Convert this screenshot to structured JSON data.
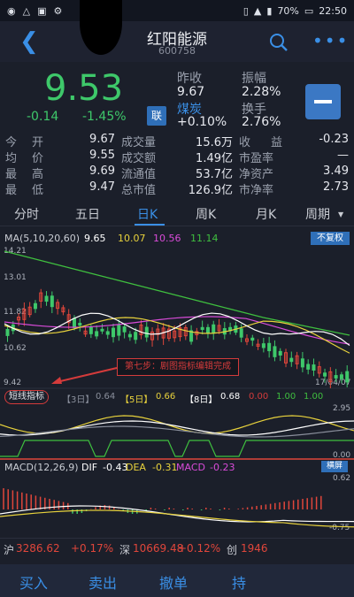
{
  "status": {
    "battery": "70%",
    "time": "22:50"
  },
  "header": {
    "title": "红阳能源",
    "code": "600758"
  },
  "quote": {
    "price": "9.53",
    "change": "-0.14",
    "change_pct": "-1.45%",
    "link_badge": "联",
    "prev_close_label": "昨收",
    "prev_close": "9.67",
    "sector_label": "煤炭",
    "sector_change": "+0.10%",
    "amplitude_label": "振幅",
    "amplitude": "2.28%",
    "turnover_label": "换手",
    "turnover": "2.76%"
  },
  "stats": [
    {
      "l1": "今",
      "l2": "开",
      "v": "9.67",
      "l3": "成交量",
      "v2": "15.6万",
      "l4": "收",
      "l5": "益",
      "v3": "-0.23"
    },
    {
      "l1": "均",
      "l2": "价",
      "v": "9.55",
      "l3": "成交额",
      "v2": "1.49亿",
      "l4": "市盈率",
      "l5": "",
      "v3": "—"
    },
    {
      "l1": "最",
      "l2": "高",
      "v": "9.69",
      "l3": "流通值",
      "v2": "53.7亿",
      "l4": "净资产",
      "l5": "",
      "v3": "3.49"
    },
    {
      "l1": "最",
      "l2": "低",
      "v": "9.47",
      "l3": "总市值",
      "v2": "126.9亿",
      "l4": "市净率",
      "l5": "",
      "v3": "2.73"
    }
  ],
  "tabs": [
    "分时",
    "五日",
    "日K",
    "周K",
    "月K",
    "周期"
  ],
  "active_tab": "日K",
  "ma_legend": {
    "label": "MA(5,10,20,60)",
    "v5": "9.65",
    "v10": "10.07",
    "v20": "10.56",
    "v60": "11.14",
    "adjust_button": "不复权"
  },
  "price_axis": [
    "14.21",
    "13.01",
    "11.82",
    "10.62",
    "9.42"
  ],
  "date_label": "17/04/07",
  "annotation": "第七步：剧图指标编辑完成",
  "indicator": {
    "name": "短线指标",
    "d3_label": "【3日】",
    "d3": "0.64",
    "d5_label": "【5日】",
    "d5": "0.66",
    "d8_label": "【8日】",
    "d8": "0.68",
    "v1": "0.00",
    "v2": "1.00",
    "v3": "1.00",
    "axis_top": "2.95",
    "axis_bottom": "0.00"
  },
  "macd": {
    "label": "MACD(12,26,9)",
    "dif_label": "DIF",
    "dif": "-0.43",
    "dea_label": "DEA",
    "dea": "-0.31",
    "macd_label": "MACD",
    "macd": "-0.23",
    "landscape_button": "横屏",
    "axis_top": "0.62",
    "axis_bottom": "-0.75"
  },
  "ticker": {
    "sh_label": "沪",
    "sh": "3286.62",
    "sh_pct": "+0.17%",
    "sz_label": "深",
    "sz": "10669.48",
    "sz_pct": "+0.12%",
    "cy_label": "创",
    "cy": "1946"
  },
  "trade": [
    "买入",
    "卖出",
    "撤单",
    "持"
  ],
  "colors": {
    "up": "#e0463b",
    "down": "#3ec86a",
    "accent": "#3a8fe6",
    "ma5": "#ffffff",
    "ma10": "#e8d23c",
    "ma20": "#d94bd9",
    "ma60": "#3fbf3f"
  }
}
